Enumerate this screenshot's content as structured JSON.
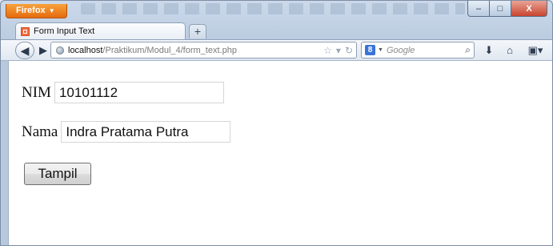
{
  "browser": {
    "menu_button": "Firefox",
    "tab_title": "Form Input Text",
    "new_tab": "+",
    "url_host": "localhost",
    "url_path": "/Praktikum/Modul_4/form_text.php",
    "search_placeholder": "Google",
    "search_engine_icon": "google-icon",
    "window_controls": {
      "minimize": "–",
      "maximize": "□",
      "close": "X"
    }
  },
  "form": {
    "nim_label": "NIM",
    "nim_value": "10101112",
    "nama_label": "Nama",
    "nama_value": "Indra Pratama Putra",
    "submit_label": "Tampil"
  },
  "colors": {
    "firefox_button": "#e66b10",
    "content_bg": "#ffffff"
  }
}
